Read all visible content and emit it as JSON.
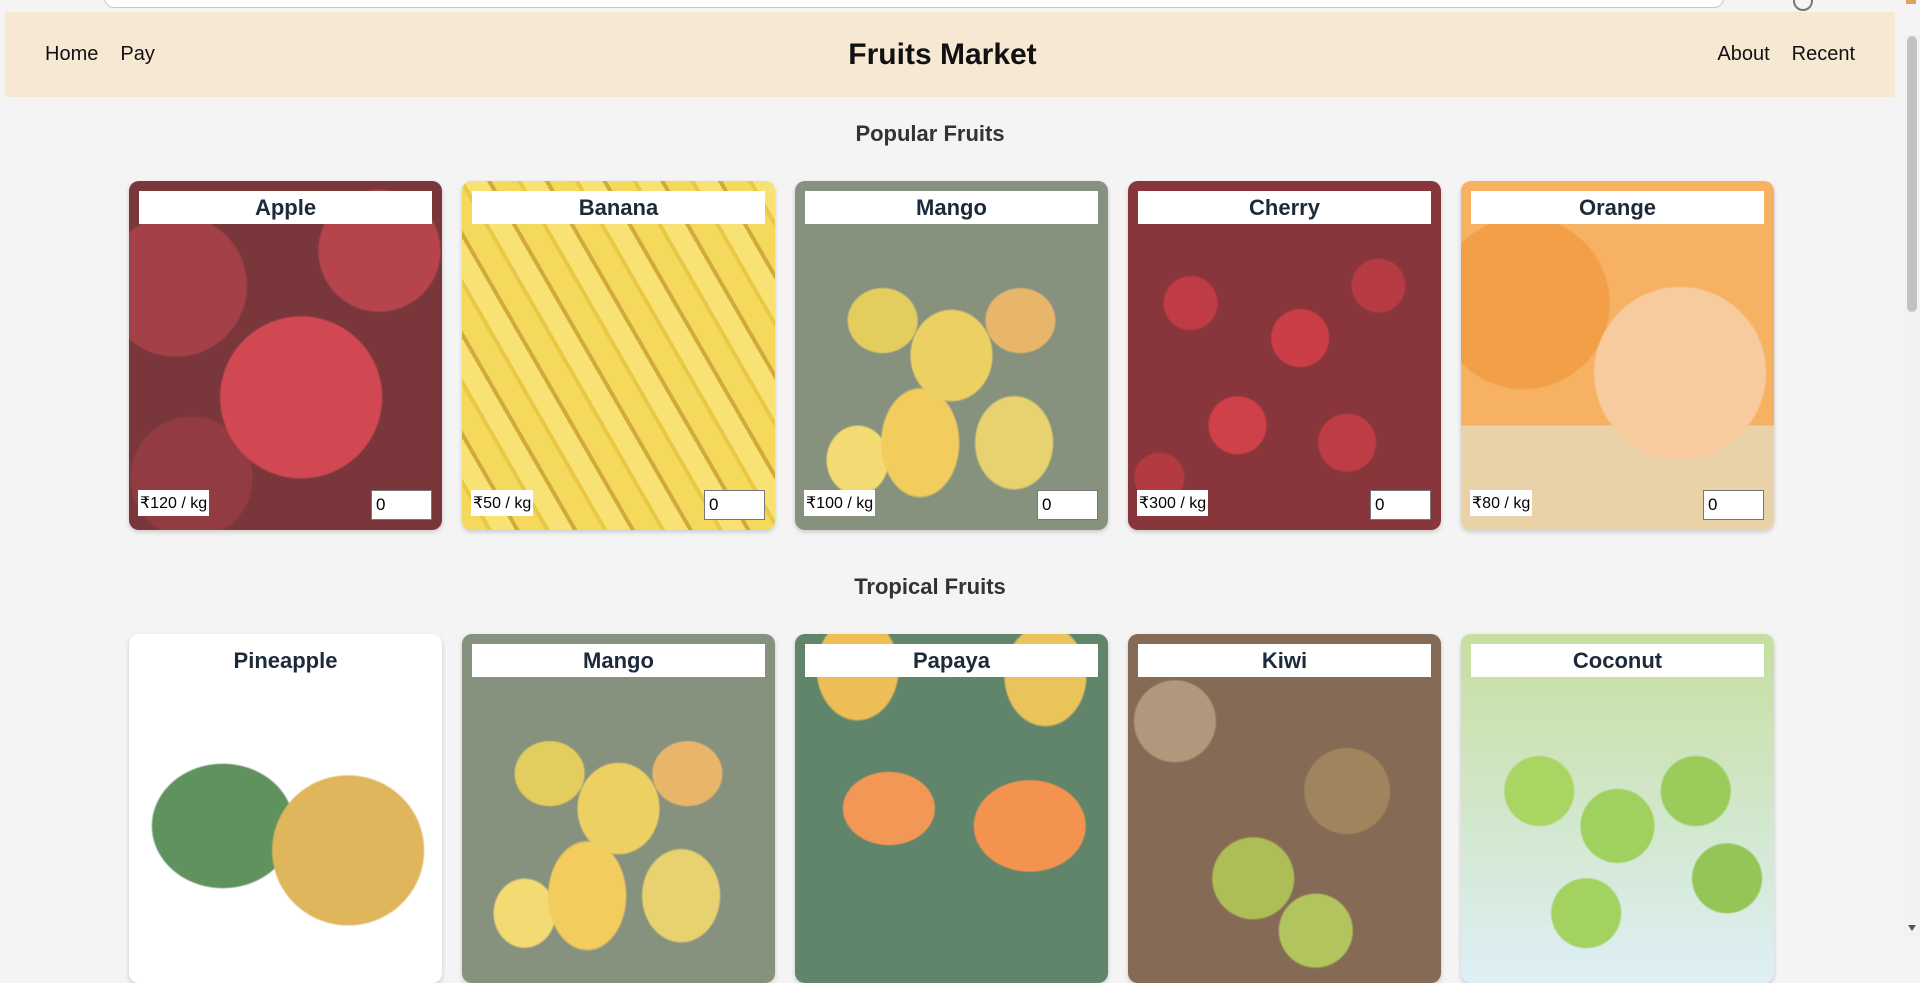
{
  "header": {
    "title": "Fruits Market",
    "nav_left": [
      "Home",
      "Pay"
    ],
    "nav_right": [
      "About",
      "Recent"
    ]
  },
  "sections": [
    {
      "title": "Popular Fruits",
      "cards": [
        {
          "name": "Apple",
          "price": "₹120 / kg",
          "quantity": "0"
        },
        {
          "name": "Banana",
          "price": "₹50 / kg",
          "quantity": "0"
        },
        {
          "name": "Mango",
          "price": "₹100 / kg",
          "quantity": "0"
        },
        {
          "name": "Cherry",
          "price": "₹300 / kg",
          "quantity": "0"
        },
        {
          "name": "Orange",
          "price": "₹80 / kg",
          "quantity": "0"
        }
      ]
    },
    {
      "title": "Tropical Fruits",
      "cards": [
        {
          "name": "Pineapple"
        },
        {
          "name": "Mango"
        },
        {
          "name": "Papaya"
        },
        {
          "name": "Kiwi"
        },
        {
          "name": "Coconut"
        }
      ]
    }
  ]
}
